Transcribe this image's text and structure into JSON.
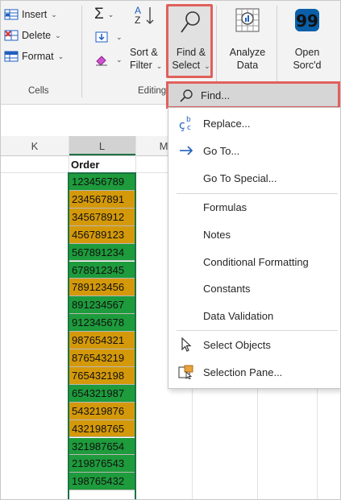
{
  "ribbon": {
    "cells": {
      "insert": "Insert",
      "delete": "Delete",
      "format": "Format",
      "group_label": "Cells"
    },
    "editing": {
      "autosum_symbol": "Σ",
      "sort_filter_line1": "Sort &",
      "sort_filter_line2": "Filter",
      "find_select_line1": "Find &",
      "find_select_line2": "Select",
      "group_label": "Editing"
    },
    "analysis": {
      "analyze_line1": "Analyze",
      "analyze_line2": "Data"
    },
    "open_sorcd": {
      "line1": "Open",
      "line2": "Sorc'd"
    }
  },
  "grid": {
    "column_headers": [
      "K",
      "L",
      "M"
    ],
    "order_header": "Order",
    "cells": [
      {
        "value": "123456789",
        "color": "green"
      },
      {
        "value": "234567891",
        "color": "orange"
      },
      {
        "value": "345678912",
        "color": "orange"
      },
      {
        "value": "456789123",
        "color": "orange"
      },
      {
        "value": "567891234",
        "color": "green"
      },
      {
        "value": "678912345",
        "color": "green"
      },
      {
        "value": "789123456",
        "color": "orange"
      },
      {
        "value": "891234567",
        "color": "green"
      },
      {
        "value": "912345678",
        "color": "green"
      },
      {
        "value": "987654321",
        "color": "orange"
      },
      {
        "value": "876543219",
        "color": "orange"
      },
      {
        "value": "765432198",
        "color": "orange"
      },
      {
        "value": "654321987",
        "color": "green"
      },
      {
        "value": "543219876",
        "color": "orange"
      },
      {
        "value": "432198765",
        "color": "orange"
      },
      {
        "value": "321987654",
        "color": "green"
      },
      {
        "value": "219876543",
        "color": "green"
      },
      {
        "value": "198765432",
        "color": "green"
      }
    ],
    "colors": {
      "green": "#1e9b3c",
      "orange": "#d4990a",
      "selection": "#1e7145"
    }
  },
  "menu": {
    "find": "Find...",
    "replace": "Replace...",
    "goto": "Go To...",
    "goto_special": "Go To Special...",
    "formulas": "Formulas",
    "notes": "Notes",
    "conditional_formatting": "Conditional Formatting",
    "constants": "Constants",
    "data_validation": "Data Validation",
    "select_objects": "Select Objects",
    "selection_pane": "Selection Pane..."
  },
  "highlight_color": "#e0605c"
}
